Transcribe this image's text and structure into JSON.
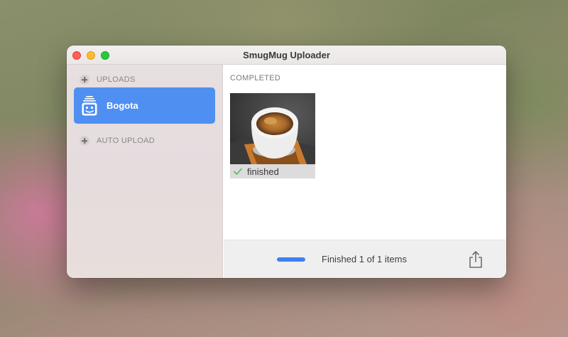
{
  "window": {
    "title": "SmugMug Uploader"
  },
  "sidebar": {
    "uploads_label": "UPLOADS",
    "items": [
      {
        "label": "Bogota",
        "icon": "album-icon",
        "selected": true
      }
    ],
    "auto_upload_label": "AUTO UPLOAD"
  },
  "content": {
    "section_label": "COMPLETED",
    "items": [
      {
        "caption": "finished",
        "status_icon": "check-icon"
      }
    ]
  },
  "footer": {
    "status": "Finished 1 of 1 items",
    "progress": 1.0
  },
  "colors": {
    "accent": "#4f8ff2",
    "progress": "#3f7ff0",
    "check": "#5cb85c"
  }
}
